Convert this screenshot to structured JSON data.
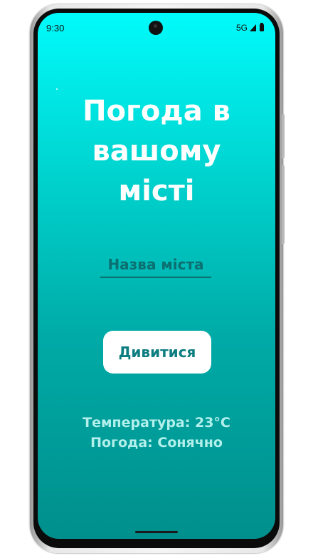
{
  "status_bar": {
    "time": "9:30",
    "network": "5G",
    "icons": [
      "signal-icon",
      "battery-icon"
    ]
  },
  "app": {
    "title": "Погода в\nвашому\nмісті",
    "city_input": {
      "placeholder": "Назва міста",
      "value": ""
    },
    "view_button_label": "Дивитися",
    "temperature_text": "Температура: 23°C",
    "weather_text": "Погода: Сонячно"
  },
  "colors": {
    "gradient_top": "#00fbfb",
    "gradient_bottom": "#008f8c",
    "title": "#ffffff",
    "input_text": "#0c6f70",
    "button_bg": "#ffffff",
    "button_text": "#0c7d80",
    "info_text": "#b3f0ec"
  }
}
